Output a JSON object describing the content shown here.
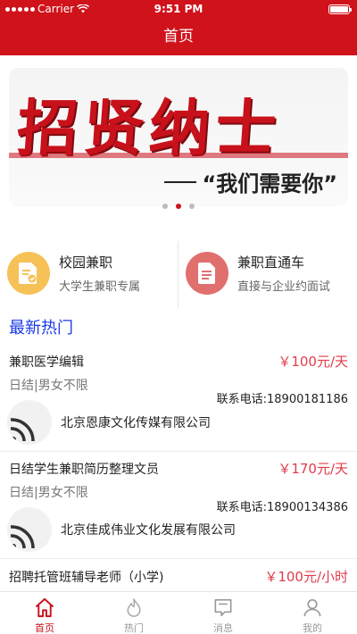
{
  "status": {
    "carrier": "Carrier",
    "time": "9:51 PM"
  },
  "nav": {
    "title": "首页"
  },
  "banner": {
    "headline": "招贤纳士",
    "slogan": "“我们需要你”",
    "pages": 3,
    "active_page": 2
  },
  "features": [
    {
      "title": "校园兼职",
      "subtitle": "大学生兼职专属",
      "icon": "document-check-icon",
      "color": "#f6c156"
    },
    {
      "title": "兼职直通车",
      "subtitle": "直接与企业约面试",
      "icon": "document-list-icon",
      "color": "#e0706e"
    }
  ],
  "section": {
    "title": "最新热门"
  },
  "jobs": [
    {
      "title": "兼职医学编辑",
      "salary": "￥100元/天",
      "tags": "日结|男女不限",
      "phone": "联系电话:18900181186",
      "company": "北京恩康文化传媒有限公司"
    },
    {
      "title": "日结学生兼职简历整理文员",
      "salary": "￥170元/天",
      "tags": "日结|男女不限",
      "phone": "联系电话:18900134386",
      "company": "北京佳成伟业文化发展有限公司"
    },
    {
      "title": "招聘托管班辅导老师（小学)",
      "salary": "￥100元/小时"
    }
  ],
  "tabs": [
    {
      "label": "首页",
      "icon": "home-icon",
      "active": true
    },
    {
      "label": "热门",
      "icon": "flame-icon",
      "active": false
    },
    {
      "label": "消息",
      "icon": "message-icon",
      "active": false
    },
    {
      "label": "我的",
      "icon": "user-icon",
      "active": false
    }
  ],
  "colors": {
    "brand": "#d0121b",
    "salary": "#e23c4c",
    "section": "#1a3ae6"
  }
}
